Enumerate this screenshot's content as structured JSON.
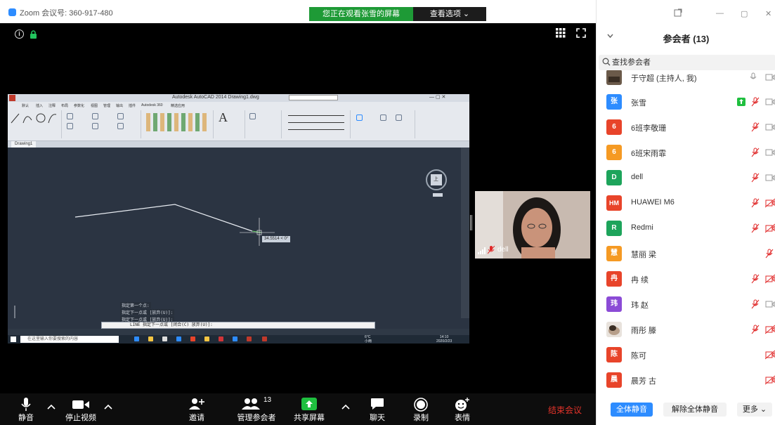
{
  "zoom": {
    "meeting_title": "Zoom 会议号: 360-917-480",
    "viewing_banner": "您正在观看张雪的屏幕",
    "view_options": "查看选项 ⌄"
  },
  "autocad": {
    "title": "Autodesk AutoCAD 2014  Drawing1.dwg",
    "file_tab": "Drawing1",
    "tabs": [
      "默认",
      "插入",
      "注释",
      "布局",
      "参数化",
      "视图",
      "管理",
      "输出",
      "插件",
      "Autodesk 360",
      "精选应用"
    ],
    "cmd_history": [
      "指定第一个点:",
      "指定下一点或 [放弃(U)]:",
      "指定下一点或 [放弃(U)]:"
    ],
    "cmd_input": "LINE 指定下一点或 [闭合(C) 放弃(U)]:",
    "dim_tooltip": "34.5514 < 0°",
    "search_placeholder": "在这里输入你要搜索的内容",
    "clock_time": "14:10",
    "clock_date": "2020/2/23",
    "weather": "6°C",
    "weather_desc": "小雨",
    "viewcube_label": "上"
  },
  "video": {
    "name": "dell"
  },
  "toolbar": {
    "mute": "静音",
    "stop_video": "停止视频",
    "invite": "邀请",
    "manage": "管理参会者",
    "manage_count": "13",
    "share": "共享屏幕",
    "chat": "聊天",
    "record": "录制",
    "reactions": "表情",
    "end_meeting": "结束会议"
  },
  "panel": {
    "title": "参会者 (13)",
    "search_placeholder": "查找参会者",
    "mute_all": "全体静音",
    "unmute_all": "解除全体静音",
    "more": "更多 ⌄"
  },
  "colors": {
    "zoom_blue": "#2d8cff",
    "banner_green": "#1e9a36",
    "end_red": "#e5332a",
    "muted_red": "#e02828"
  },
  "participants": [
    {
      "initial": "",
      "name": "于守超 (主持人, 我)",
      "color": "#6b5a4a",
      "icon": "photo-avatar"
    },
    {
      "initial": "张",
      "name": "张雪",
      "color": "#2d8cff",
      "icon": "letter-avatar"
    },
    {
      "initial": "6",
      "name": "6班李敬珊",
      "color": "#e8442a",
      "icon": "letter-avatar"
    },
    {
      "initial": "6",
      "name": "6班宋雨霏",
      "color": "#f59a23",
      "icon": "letter-avatar"
    },
    {
      "initial": "D",
      "name": "dell",
      "color": "#1da45b",
      "icon": "letter-avatar"
    },
    {
      "initial": "HM",
      "name": "HUAWEI M6",
      "color": "#e8442a",
      "icon": "letter-avatar"
    },
    {
      "initial": "R",
      "name": "Redmi",
      "color": "#1da45b",
      "icon": "letter-avatar"
    },
    {
      "initial": "慧",
      "name": "慧丽 梁",
      "color": "#f59a23",
      "icon": "letter-avatar"
    },
    {
      "initial": "冉",
      "name": "冉 续",
      "color": "#e8442a",
      "icon": "letter-avatar"
    },
    {
      "initial": "玮",
      "name": "玮 赵",
      "color": "#8b4bd6",
      "icon": "letter-avatar"
    },
    {
      "initial": "",
      "name": "雨彤 滕",
      "color": "#cfc2b6",
      "icon": "photo-avatar"
    },
    {
      "initial": "陈",
      "name": "陈可",
      "color": "#e8442a",
      "icon": "letter-avatar"
    },
    {
      "initial": "晨",
      "name": "晨芳 古",
      "color": "#e8442a",
      "icon": "letter-avatar"
    }
  ]
}
